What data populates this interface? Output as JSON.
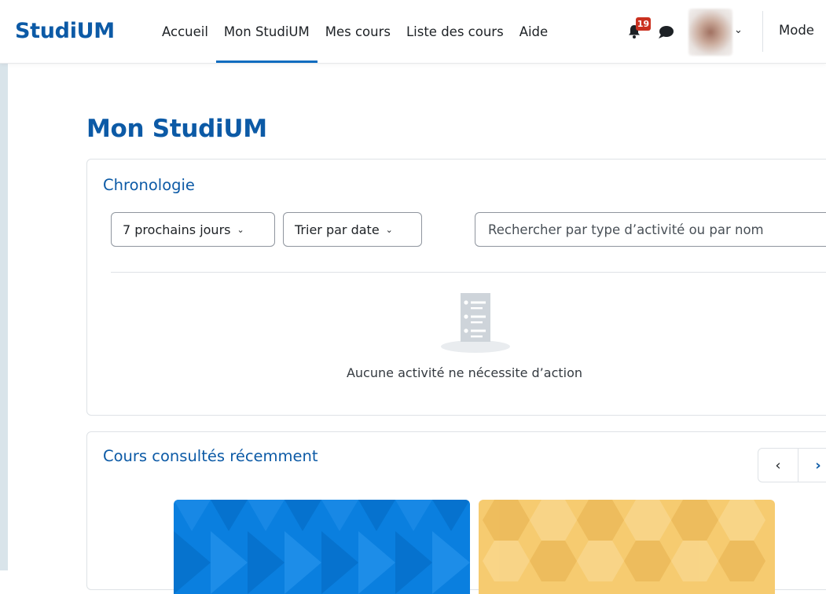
{
  "navbar": {
    "brand": "StudiUM",
    "items": [
      {
        "label": "Accueil",
        "active": false
      },
      {
        "label": "Mon StudiUM",
        "active": true
      },
      {
        "label": "Mes cours",
        "active": false
      },
      {
        "label": "Liste des cours",
        "active": false
      },
      {
        "label": "Aide",
        "active": false
      }
    ],
    "notification_count": "19",
    "mode_label": "Mode"
  },
  "page": {
    "title": "Mon StudiUM"
  },
  "timeline": {
    "title": "Chronologie",
    "filter_days": "7 prochains jours",
    "sort": "Trier par date",
    "search_placeholder": "Rechercher par type d’activité ou par nom",
    "empty_message": "Aucune activité ne nécessite d’action"
  },
  "recent_courses": {
    "title": "Cours consultés récemment",
    "prev_symbol": "‹",
    "next_symbol": "›"
  },
  "colors": {
    "brand": "#0c5aa6",
    "accent": "#0f6cbf",
    "badge": "#ca3120",
    "course_a": "#0a7fdf",
    "course_b": "#f6cb70"
  }
}
